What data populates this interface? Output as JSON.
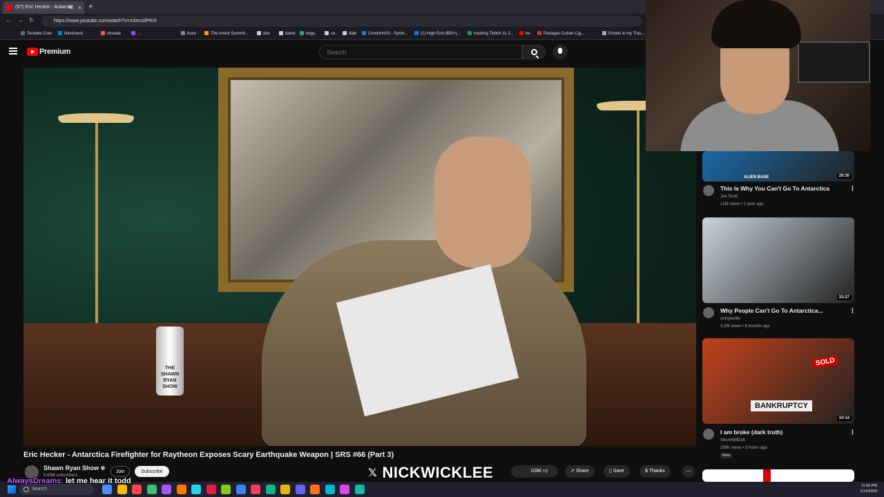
{
  "browser": {
    "tab_title": "(57) Eric Hecker - Antarctic",
    "url": "https://www.youtube.com/watch?v=rckecs0PKI4",
    "bookmarks": [
      {
        "label": "Teradek Core",
        "color": "#666666"
      },
      {
        "label": "Nextcloud",
        "color": "#0082c9"
      },
      {
        "label": "streade",
        "color": "#ff5555"
      },
      {
        "label": "...",
        "color": "#9146ff"
      },
      {
        "label": "buce",
        "color": "#888888"
      },
      {
        "label": "The Arrest Summit...",
        "color": "#ff9900"
      },
      {
        "label": "dan",
        "color": "#cccccc"
      },
      {
        "label": "damit",
        "color": "#cccccc"
      },
      {
        "label": "begu",
        "color": "#33aa66"
      },
      {
        "label": "ca",
        "color": "#cccccc"
      },
      {
        "label": "diab",
        "color": "#cccccc"
      },
      {
        "label": "CondorNAS - Synol...",
        "color": "#2277cc"
      },
      {
        "label": "(1) High End ($50+)...",
        "color": "#1877f2"
      },
      {
        "label": "tracking Twitch 11-2...",
        "color": "#0f9d58"
      },
      {
        "label": "be",
        "color": "#ff0000"
      },
      {
        "label": "Partagas Cuban Cig...",
        "color": "#cc3333"
      },
      {
        "label": "Emails in my Tras...",
        "color": "#aaaaaa"
      }
    ]
  },
  "youtube": {
    "brand": "Premium",
    "search_placeholder": "Search",
    "video_title": "Eric Hecker - Antarctica Firefighter for Raytheon Exposes Scary Earthquake Weapon | SRS #66 (Part 3)",
    "video_overlay_text": "THE SHAWN RYAN SHOW",
    "channel_name": "Shawn Ryan Show",
    "subscriber_count": "5.63M subscribers",
    "join_label": "Join",
    "subscribe_label": "Subscribe",
    "like_count": "103K",
    "share_label": "Share",
    "save_label": "Save",
    "thanks_label": "Thanks",
    "more_label": "..."
  },
  "recommendations": [
    {
      "title": "This Is Why You Can't Go To Antarctica",
      "channel": "Joe Scott",
      "meta": "12M views • 1 year ago",
      "duration": "29:30",
      "thumb_color": "#1b6aa8",
      "thumb_text": "ALIEN BASE"
    },
    {
      "title": "Why People Can't Go To Antarctica...",
      "channel": "oompaville",
      "meta": "3.2M views • 6 months ago",
      "duration": "33:27",
      "thumb_color": "#c8d4dc",
      "thumb_text": ""
    },
    {
      "title": "I am broke (dark truth)",
      "channel": "SteveWillDoIt",
      "meta": "258K views • 3 hours ago",
      "duration": "34:14",
      "thumb_color": "#c2421a",
      "thumb_text": "BANKRUPTCY",
      "badge": "New",
      "tag": "SOLD"
    }
  ],
  "stream_overlay": {
    "chat_user": "AlwaysDreams:",
    "chat_message": " let me hear it todd",
    "handle": "NICKWICKLEE"
  },
  "taskbar": {
    "search_placeholder": "Search",
    "time": "11:00 PM",
    "date": "1/14/2026",
    "app_colors": [
      "#4e8cff",
      "#ffb900",
      "#ff4444",
      "#38c172",
      "#a855f7",
      "#ff7a00",
      "#22d3ee",
      "#e11d48",
      "#84cc16",
      "#3b82f6",
      "#f43f5e",
      "#10b981",
      "#eab308",
      "#6366f1",
      "#f97316",
      "#06b6d4",
      "#d946ef",
      "#14b8a6"
    ]
  }
}
